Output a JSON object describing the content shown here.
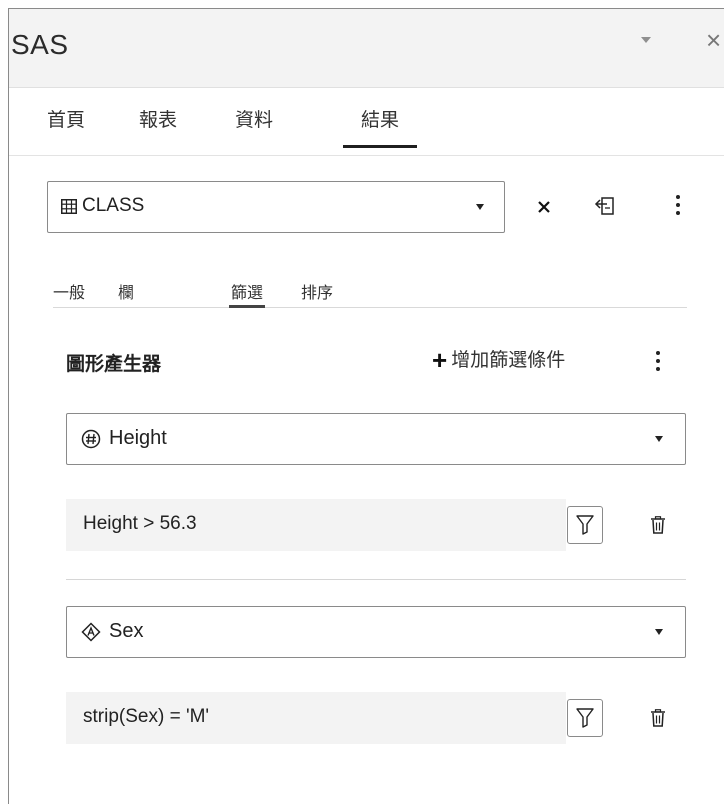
{
  "app": {
    "title": "SAS"
  },
  "main_tabs": [
    {
      "label": "首頁"
    },
    {
      "label": "報表"
    },
    {
      "label": "資料"
    },
    {
      "label": "結果",
      "active": true
    }
  ],
  "table_selector": {
    "value": "CLASS",
    "icon": "table-grid-icon"
  },
  "toolbar": {
    "close_icon": "close-icon",
    "export_icon": "export-icon",
    "more_icon": "more-vertical-icon"
  },
  "sub_tabs": [
    {
      "label": "一般"
    },
    {
      "label": "欄"
    },
    {
      "label": "篩選",
      "active": true
    },
    {
      "label": "排序"
    }
  ],
  "filter_panel": {
    "title": "圖形產生器",
    "add_label": "增加篩選條件",
    "filters": [
      {
        "column": "Height",
        "column_type_icon": "numeric-column-icon",
        "expression": "Height > 56.3"
      },
      {
        "column": "Sex",
        "column_type_icon": "character-column-icon",
        "expression": "strip(Sex) = 'M'"
      }
    ]
  },
  "colors": {
    "titlebar_bg": "#f3f3f3",
    "expression_bg": "#f3f3f3",
    "active_tab_underline": "#1f1f1f"
  }
}
